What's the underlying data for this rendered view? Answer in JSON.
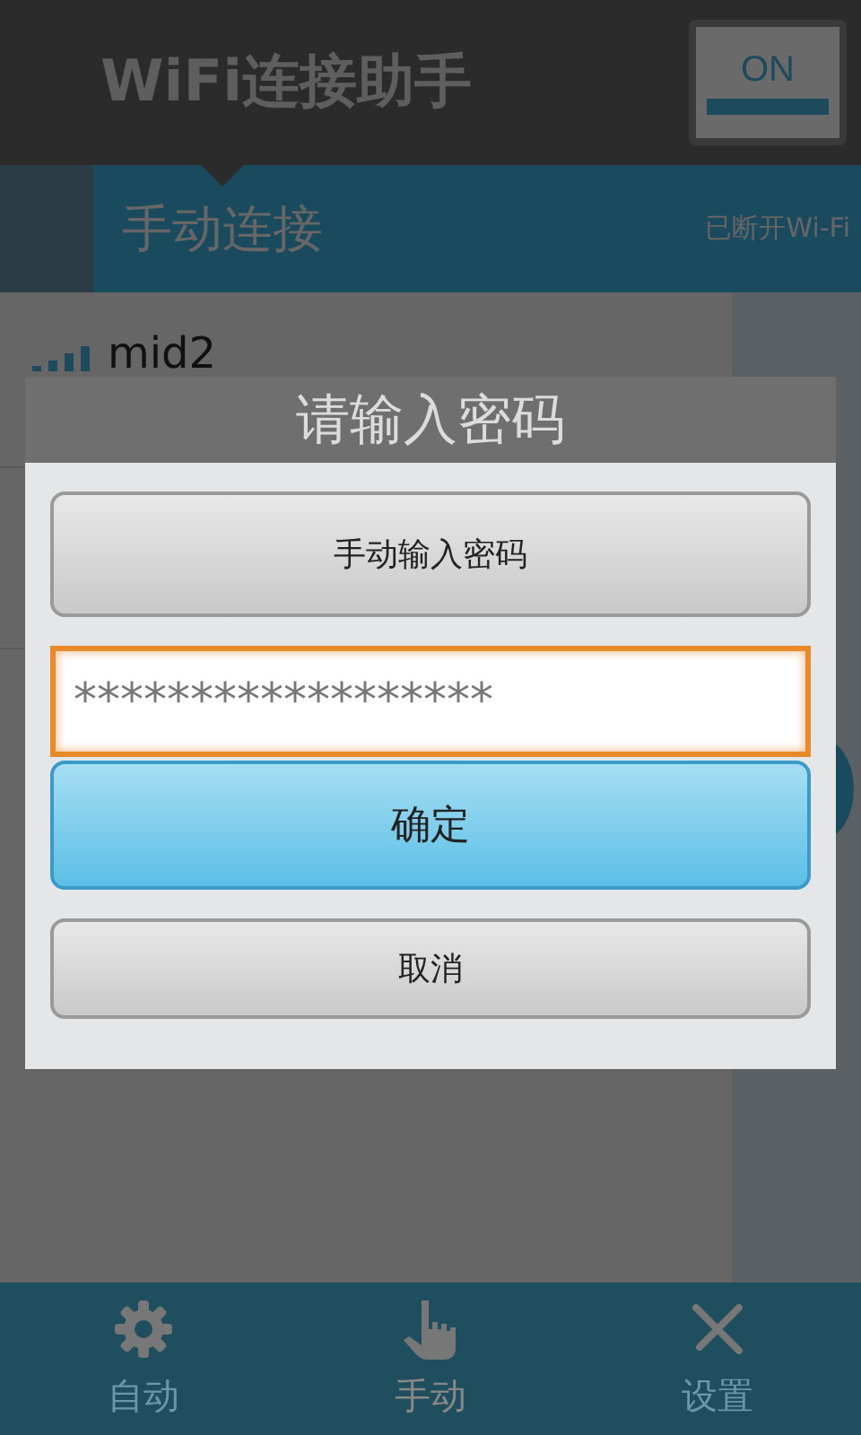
{
  "header": {
    "title": "WiFi连接助手",
    "switch": {
      "label": "ON",
      "on": true
    }
  },
  "section": {
    "title": "手动连接",
    "status": "已断开Wi-Fi"
  },
  "networks": [
    {
      "name": "mid2"
    }
  ],
  "dialog": {
    "title": "请输入密码",
    "manual_button": "手动输入密码",
    "password": {
      "value": "******************",
      "focused": true
    },
    "confirm": "确定",
    "cancel": "取消"
  },
  "nav": [
    {
      "label": "自动",
      "selected": false
    },
    {
      "label": "手动",
      "selected": true
    },
    {
      "label": "设置",
      "selected": false
    }
  ]
}
